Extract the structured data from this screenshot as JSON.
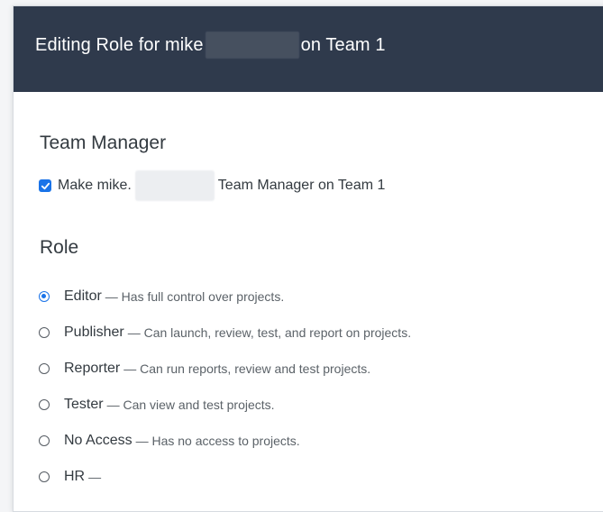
{
  "dialog": {
    "title_prefix": "Editing Role for mike",
    "title_suffix": "on Team 1"
  },
  "team_manager": {
    "heading": "Team Manager",
    "checkbox_checked": true,
    "checkbox_prefix": "Make mike.",
    "checkbox_suffix": "Team Manager on Team 1"
  },
  "role": {
    "heading": "Role",
    "selected": "Editor",
    "options": [
      {
        "name": "Editor",
        "desc": "— Has full control over projects."
      },
      {
        "name": "Publisher",
        "desc": "— Can launch, review, test, and report on projects."
      },
      {
        "name": "Reporter",
        "desc": "— Can run reports, review and test projects."
      },
      {
        "name": "Tester",
        "desc": "— Can view and test projects."
      },
      {
        "name": "No Access",
        "desc": "— Has no access to projects."
      },
      {
        "name": "HR",
        "desc": "—"
      }
    ]
  },
  "colors": {
    "header_bg": "#2f3a4c",
    "accent": "#1a73e8"
  }
}
